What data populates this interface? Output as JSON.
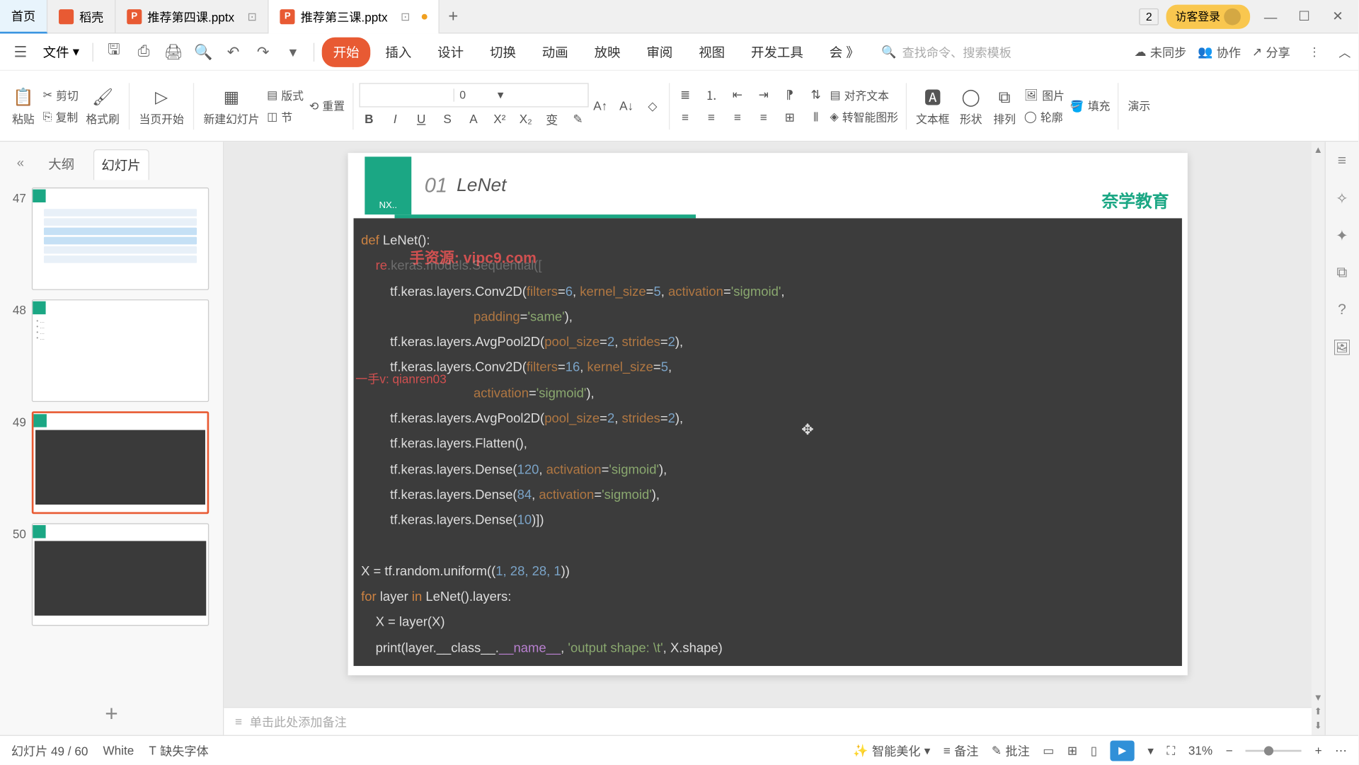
{
  "titlebar": {
    "tabs": [
      {
        "label": "首页",
        "type": "home"
      },
      {
        "label": "稻壳",
        "type": "dk"
      },
      {
        "label": "推荐第四课.pptx",
        "type": "file"
      },
      {
        "label": "推荐第三课.pptx",
        "type": "file",
        "active": true,
        "modified": true
      }
    ],
    "count": "2",
    "login": "访客登录"
  },
  "menubar": {
    "file": "文件",
    "tabs": [
      "开始",
      "插入",
      "设计",
      "切换",
      "动画",
      "放映",
      "审阅",
      "视图",
      "开发工具",
      "会 》"
    ],
    "active_tab": "开始",
    "search_placeholder": "查找命令、搜索模板",
    "sync": "未同步",
    "collab": "协作",
    "share": "分享"
  },
  "ribbon": {
    "paste": "粘贴",
    "cut": "剪切",
    "copy": "复制",
    "format_painter": "格式刷",
    "from_current": "当页开始",
    "new_slide": "新建幻灯片",
    "layout": "版式",
    "section": "节",
    "reset": "重置",
    "font_size": "0",
    "align_text": "对齐文本",
    "smart_graphic": "转智能图形",
    "textbox": "文本框",
    "shapes": "形状",
    "arrange": "排列",
    "picture": "图片",
    "fill": "填充",
    "outline": "轮廓",
    "present": "演示"
  },
  "left_panel": {
    "outline": "大纲",
    "slides": "幻灯片",
    "thumbs": [
      {
        "num": "47"
      },
      {
        "num": "48"
      },
      {
        "num": "49",
        "selected": true
      },
      {
        "num": "50"
      }
    ]
  },
  "slide": {
    "nx": "NX..",
    "num": "01",
    "title": "LeNet",
    "brand": "奈学教育",
    "watermark1": "手资源:   vipc9.com",
    "watermark2": "一手v: qianren03",
    "code": {
      "l1_def": "def",
      "l1_rest": " LeNet():",
      "l2a": "re",
      "l2b": ".keras.models.Sequential([",
      "l3a": "tf.keras.layers.Conv2D(",
      "l3_filters": "filters",
      "l3_eq1": "=",
      "l3_v1": "6",
      "l3_c1": ", ",
      "l3_kernel": "kernel_size",
      "l3_eq2": "=",
      "l3_v2": "5",
      "l3_c2": ", ",
      "l3_act": "activation",
      "l3_eq3": "=",
      "l3_v3": "'sigmoid'",
      "l3_end": ",",
      "l4_pad": "padding",
      "l4_eq": "=",
      "l4_v": "'same'",
      "l4_end": "),",
      "l5a": "tf.keras.layers.AvgPool2D(",
      "l5_ps": "pool_size",
      "l5_eq1": "=",
      "l5_v1": "2",
      "l5_c": ", ",
      "l5_st": "strides",
      "l5_eq2": "=",
      "l5_v2": "2",
      "l5_end": "),",
      "l6a": "tf.keras.layers.Conv2D(",
      "l6_f": "filters",
      "l6_eq1": "=",
      "l6_v1": "16",
      "l6_c": ", ",
      "l6_k": "kernel_size",
      "l6_eq2": "=",
      "l6_v2": "5",
      "l6_end": ",",
      "l7_act": "activation",
      "l7_eq": "=",
      "l7_v": "'sigmoid'",
      "l7_end": "),",
      "l8a": "tf.keras.layers.AvgPool2D(",
      "l8_ps": "pool_size",
      "l8_eq1": "=",
      "l8_v1": "2",
      "l8_c": ", ",
      "l8_st": "strides",
      "l8_eq2": "=",
      "l8_v2": "2",
      "l8_end": "),",
      "l9": "tf.keras.layers.Flatten(),",
      "l10a": "tf.keras.layers.Dense(",
      "l10_v1": "120",
      "l10_c": ", ",
      "l10_act": "activation",
      "l10_eq": "=",
      "l10_v2": "'sigmoid'",
      "l10_end": "),",
      "l11a": "tf.keras.layers.Dense(",
      "l11_v1": "84",
      "l11_c": ", ",
      "l11_act": "activation",
      "l11_eq": "=",
      "l11_v2": "'sigmoid'",
      "l11_end": "),",
      "l12a": "tf.keras.layers.Dense(",
      "l12_v": "10",
      "l12_end": ")])",
      "l14a": "X = tf.random.uniform((",
      "l14_v": "1, 28, 28, 1",
      "l14_end": "))",
      "l15_for": "for",
      "l15_a": " layer ",
      "l15_in": "in",
      "l15_b": " LeNet().layers:",
      "l16": "X = layer(X)",
      "l17a": "print(layer.__class__.",
      "l17_name": "__name__",
      "l17_c": ", ",
      "l17_str": "'output shape: \\t'",
      "l17_end": ", X.shape)"
    }
  },
  "notes": "单击此处添加备注",
  "statusbar": {
    "slide_count": "幻灯片 49 / 60",
    "theme": "White",
    "missing_font": "缺失字体",
    "beautify": "智能美化",
    "notes": "备注",
    "comments": "批注",
    "zoom": "31%"
  }
}
